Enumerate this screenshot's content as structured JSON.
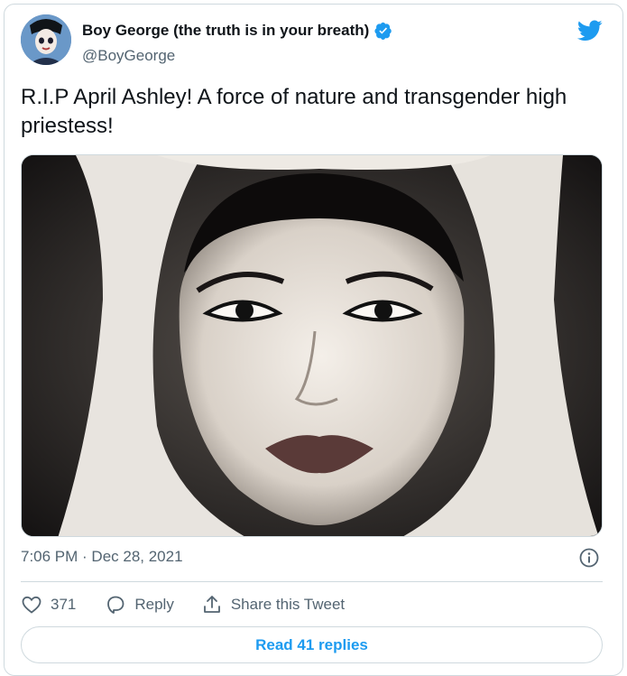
{
  "author": {
    "name": "Boy George (the truth is in your breath)",
    "handle": "@BoyGeorge",
    "verified": true
  },
  "tweet": {
    "text": "R.I.P April Ashley! A force of nature and transgender high priestess!",
    "timestamp": "7:06 PM · Dec 28, 2021"
  },
  "actions": {
    "like_count": "371",
    "reply_label": "Reply",
    "share_label": "Share this Tweet"
  },
  "replies_button": "Read 41 replies",
  "colors": {
    "accent": "#1d9bf0",
    "like": "#536471",
    "border": "#cfd9de"
  },
  "icons": [
    "twitter-bird-icon",
    "verified-badge-icon",
    "info-icon",
    "heart-icon",
    "reply-bubble-icon",
    "share-icon"
  ]
}
